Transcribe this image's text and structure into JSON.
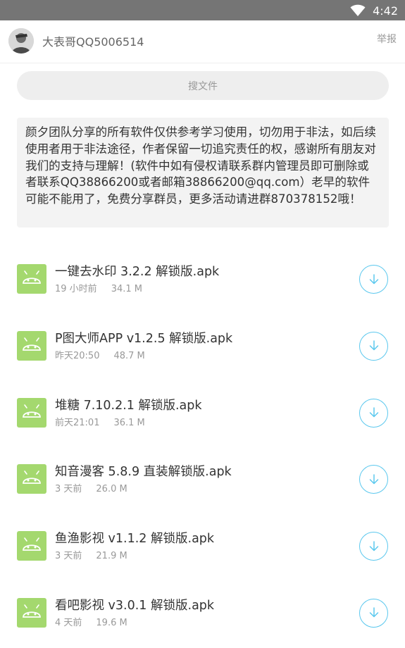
{
  "status_bar": {
    "time": "4:42",
    "wifi_icon": "wifi-icon"
  },
  "header": {
    "username": "大表哥QQ5006514",
    "report": "举报",
    "avatar_icon": "user-avatar"
  },
  "search": {
    "placeholder": "搜文件"
  },
  "notice": {
    "text": "颜夕团队分享的所有软件仅供参考学习使用，切勿用于非法，如后续使用者用于非法途径，作者保留一切追究责任的权，感谢所有朋友对我们的支持与理解！(软件中如有侵权请联系群内管理员即可删除或者联系QQ38866200或者邮箱38866200@qq.com）老早的软件可能不能用了，免费分享群员，更多活动请进群870378152哦！"
  },
  "colors": {
    "status_bar": "#757575",
    "android_icon": "#a4d86e",
    "download_accent": "#5bc8ee"
  },
  "files": [
    {
      "name": "一键去水印 3.2.2 解锁版.apk",
      "time": "19 小时前",
      "size": "34.1 M",
      "icon": "android-icon",
      "action": "download-icon"
    },
    {
      "name": "P图大师APP v1.2.5 解锁版.apk",
      "time": "昨天20:50",
      "size": "48.7 M",
      "icon": "android-icon",
      "action": "download-icon"
    },
    {
      "name": "堆糖 7.10.2.1 解锁版.apk",
      "time": "前天21:01",
      "size": "36.1 M",
      "icon": "android-icon",
      "action": "download-icon"
    },
    {
      "name": "知音漫客 5.8.9 直装解锁版.apk",
      "time": "3 天前",
      "size": "26.0 M",
      "icon": "android-icon",
      "action": "download-icon"
    },
    {
      "name": "鱼渔影视 v1.1.2 解锁版.apk",
      "time": "3 天前",
      "size": "21.9 M",
      "icon": "android-icon",
      "action": "download-icon"
    },
    {
      "name": "看吧影视 v3.0.1 解锁版.apk",
      "time": "4 天前",
      "size": "19.6 M",
      "icon": "android-icon",
      "action": "download-icon"
    }
  ]
}
